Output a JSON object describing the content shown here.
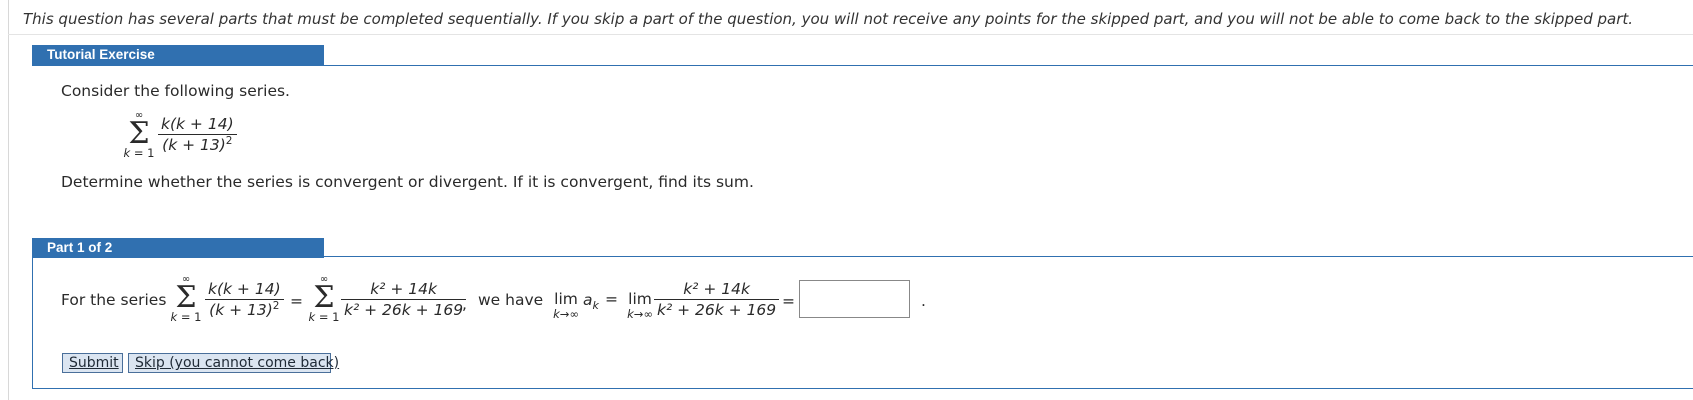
{
  "notice": "This question has several parts that must be completed sequentially. If you skip a part of the question, you will not receive any points for the skipped part, and you will not be able to come back to the skipped part.",
  "tutorial": {
    "header": "Tutorial Exercise",
    "intro": "Consider the following series.",
    "series": {
      "upper": "∞",
      "lower_var": "k",
      "lower_eq": " = 1",
      "numerator": "k(k + 14)",
      "denominator_base": "(k + 13)",
      "denominator_exp": "2"
    },
    "instruction": "Determine whether the series is convergent or divergent. If it is convergent, find its sum."
  },
  "part1": {
    "header": "Part 1 of 2",
    "lead": "For the series",
    "equals": "=",
    "expanded_num": "k² + 14k",
    "expanded_den": "k² + 26k + 169",
    "comma": ",",
    "we_have": "we have",
    "lim_word": "lim",
    "lim_sub": "k→∞",
    "a_k": "a",
    "a_k_sub": "k",
    "period": ".",
    "answer_value": "",
    "submit_label": "Submit",
    "skip_label": "Skip (you cannot come back)"
  }
}
